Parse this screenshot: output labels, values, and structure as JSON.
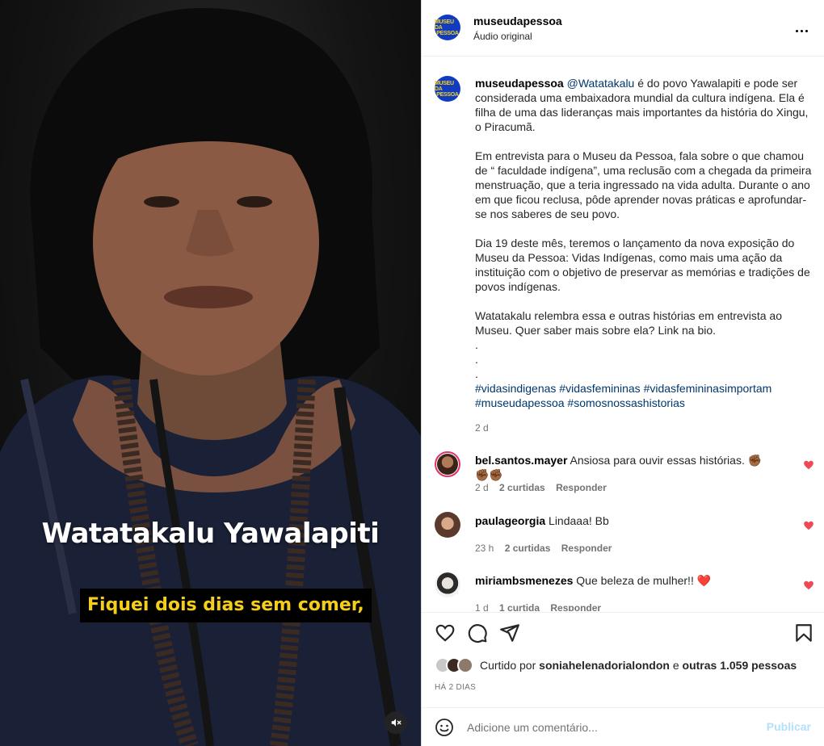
{
  "video": {
    "name_caption": "Watatakalu Yawalapiti",
    "subtitle": "Fiquei dois dias sem comer,",
    "mute_icon": "speaker-muted-icon"
  },
  "header": {
    "logo_line1": "MUSEU DA",
    "logo_line2": "PESSOA",
    "username": "museudapessoa",
    "audio_label": "Áudio original"
  },
  "caption": {
    "username": "museudapessoa",
    "mention": "@Watatakalu",
    "paragraph1_rest": " é do povo Yawalapiti e pode ser considerada uma embaixadora mundial da cultura indígena. Ela é filha de uma das lideranças mais importantes da história do Xingu, o Piracumã.",
    "paragraph2": "Em entrevista para o Museu da Pessoa, fala sobre o que chamou de “ faculdade indígena”, uma reclusão com a chegada da primeira menstruação, que a teria ingressado na vida adulta. Durante o ano em que ficou reclusa, pôde aprender novas práticas e aprofundar-se nos saberes de seu povo.",
    "paragraph3": "Dia 19 deste mês, teremos o lançamento da nova exposição do Museu da Pessoa: Vidas Indígenas, como mais uma ação da instituição com o objetivo de preservar as memórias e tradições de povos indígenas.",
    "paragraph4": "Watatakalu relembra essa e outras histórias em entrevista ao Museu. Quer saber mais sobre ela? Link na bio.\n.\n.\n.",
    "hashtags": [
      "#vidasindigenas",
      "#vidasfemininas",
      "#vidasfemininasimportam",
      "#museudapessoa",
      "#somosnossashistorias"
    ],
    "time": "2 d"
  },
  "comments": [
    {
      "username": "bel.santos.mayer",
      "text": "Ansiosa para ouvir essas histórias. ✊🏾✊🏾✊🏾",
      "time": "2 d",
      "likes": "2 curtidas",
      "reply": "Responder"
    },
    {
      "username": "paulageorgia",
      "text": "Lindaaa! Bb",
      "time": "23 h",
      "likes": "2 curtidas",
      "reply": "Responder"
    },
    {
      "username": "miriambsmenezes",
      "text": "Que beleza de mulher!! ❤️",
      "time": "1 d",
      "likes": "1 curtida",
      "reply": "Responder"
    }
  ],
  "likes": {
    "prefix": "Curtido por ",
    "user": "soniahelenadorialondon",
    "middle": " e ",
    "others": "outras 1.059 pessoas"
  },
  "posted": "HÁ 2 DIAS",
  "comment_box": {
    "placeholder": "Adicione um comentário...",
    "publish": "Publicar"
  },
  "colors": {
    "accent_link": "#00376b",
    "heart": "#ed4956",
    "publish_disabled": "#b2dffc",
    "logo_blue": "#123cc0",
    "logo_yellow": "#f5d21a",
    "subtitle_yellow": "#f5cd1b"
  }
}
